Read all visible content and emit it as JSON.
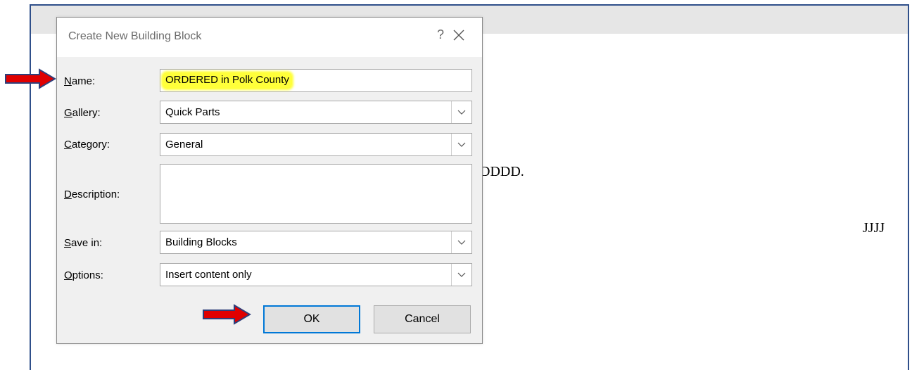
{
  "dialog": {
    "title": "Create New Building Block",
    "help_icon": "?",
    "close_icon": "close-icon"
  },
  "fields": {
    "name": {
      "label_key": "N",
      "label_rest": "ame:",
      "value": "ORDERED in Polk County"
    },
    "gallery": {
      "label_key": "G",
      "label_rest": "allery:",
      "value": "Quick Parts"
    },
    "category": {
      "label_key": "C",
      "label_rest": "ategory:",
      "value": "General"
    },
    "description": {
      "label_key": "D",
      "label_rest": "escription:",
      "value": ""
    },
    "save_in": {
      "label_key": "S",
      "label_rest": "ave in:",
      "value": "Building Blocks"
    },
    "options": {
      "label_key": "O",
      "label_rest": "ptions:",
      "value": "Insert content only"
    }
  },
  "buttons": {
    "ok": "OK",
    "cancel": "Cancel"
  },
  "document": {
    "text1": "DDDD.",
    "text2": "JJJJ"
  },
  "colors": {
    "highlight": "#ffff3a",
    "arrow": "#e00000",
    "accent": "#0078d7",
    "frame": "#2f4f8a"
  }
}
